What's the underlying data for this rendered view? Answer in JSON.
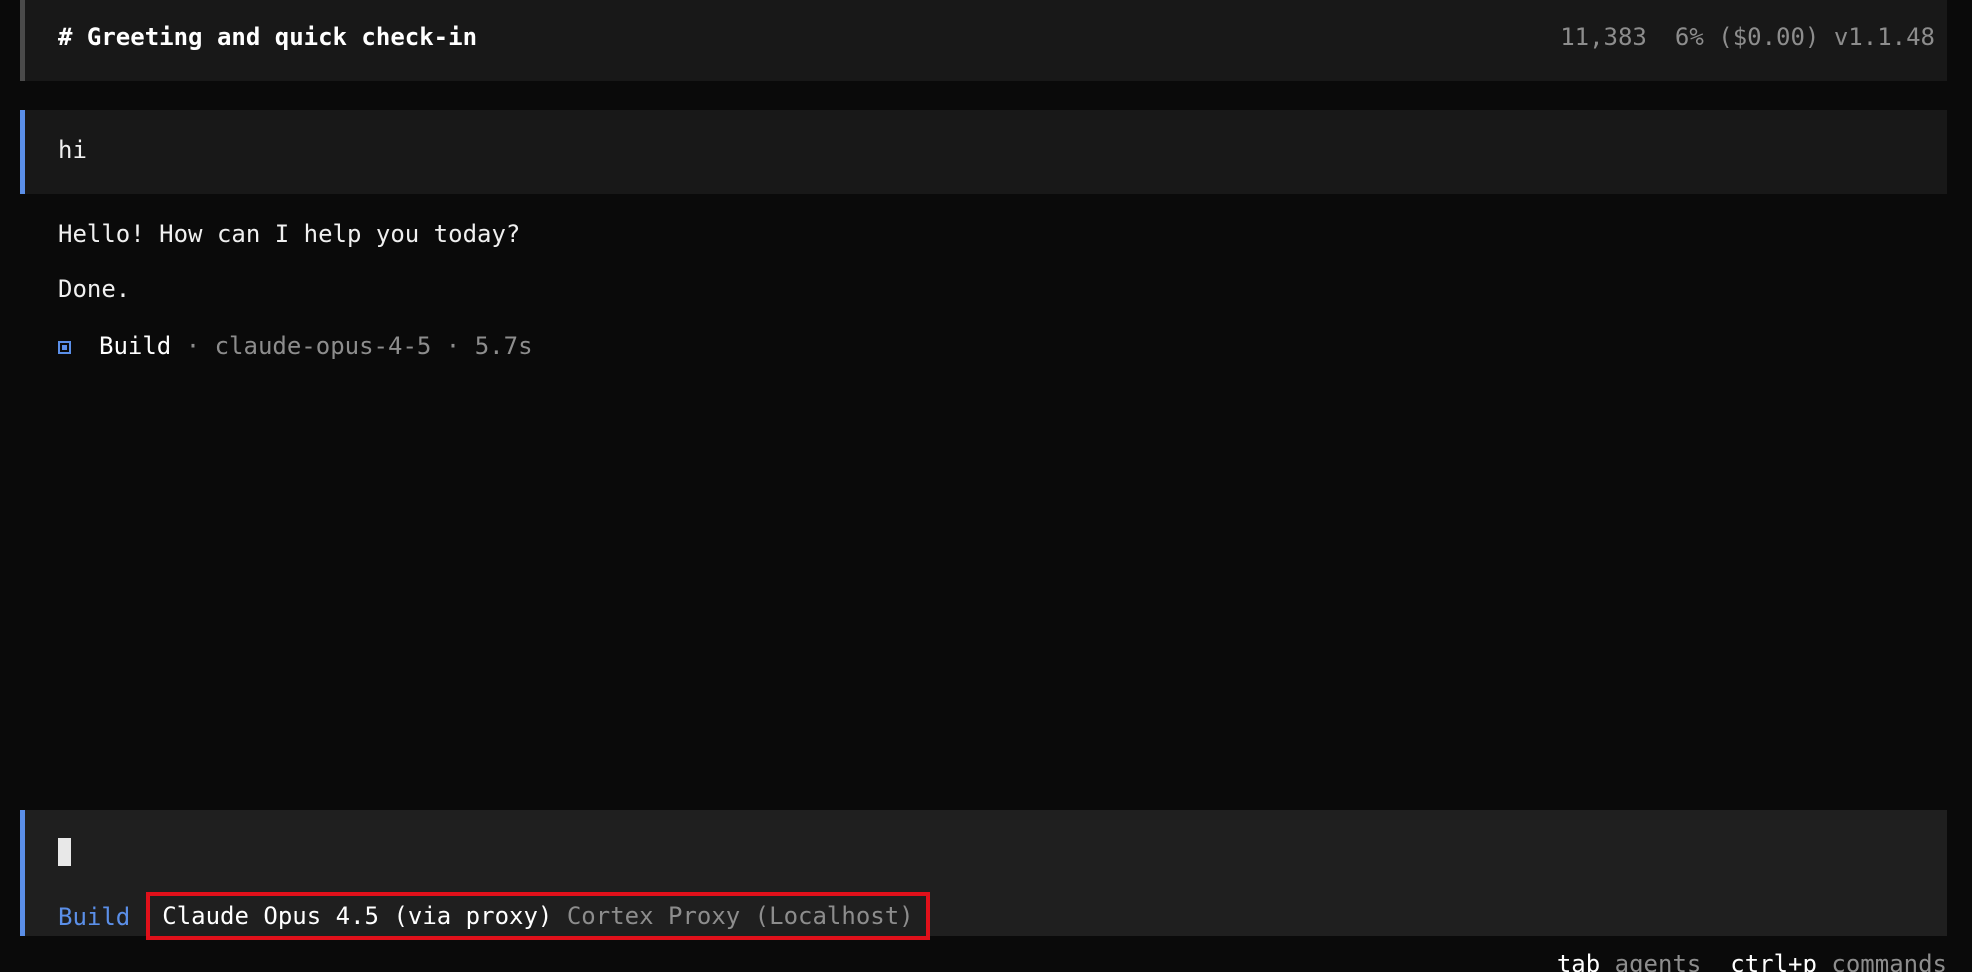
{
  "header": {
    "title": "# Greeting and quick check-in",
    "tokens": "11,383",
    "usage": "6% ($0.00)",
    "version": "v1.1.48"
  },
  "messages": {
    "user": "hi",
    "assistant_lines": [
      "Hello! How can I help you today?",
      "Done."
    ],
    "meta": {
      "icon": "square-icon",
      "agent": "Build",
      "model": "claude-opus-4-5",
      "duration": "5.7s"
    }
  },
  "input": {
    "value": "",
    "mode": "Build",
    "model_name": "Claude Opus 4.5 (via proxy)",
    "provider": "Cortex Proxy (Localhost)"
  },
  "hints": [
    {
      "key": "tab",
      "desc": "agents"
    },
    {
      "key": "ctrl+p",
      "desc": "commands"
    }
  ],
  "colors": {
    "accent": "#5b8fe8",
    "highlight_box": "#e0101a",
    "background": "#0a0a0a",
    "panel": "#181818",
    "dim_text": "#8d8d8d"
  }
}
